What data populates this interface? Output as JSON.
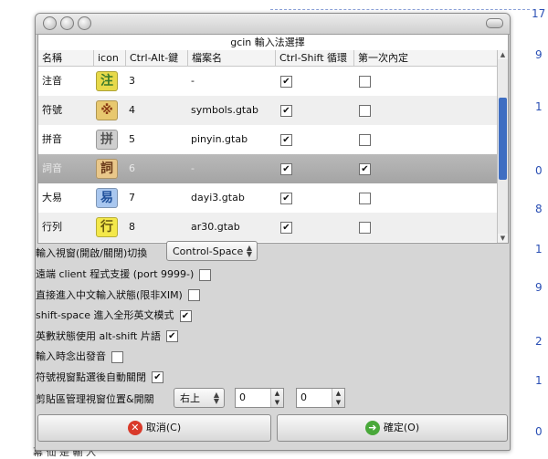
{
  "background": {
    "fragments": [
      "17",
      "9",
      "1",
      "0",
      "8",
      "1",
      "9",
      "2",
      "1",
      "0"
    ],
    "bottom_text": "幕 仙 是 輸 入"
  },
  "window": {
    "title": "gcin 輸入法選擇"
  },
  "table": {
    "columns": [
      "名稱",
      "icon",
      "Ctrl-Alt-鍵",
      "檔案名",
      "Ctrl-Shift 循環",
      "第一次內定"
    ],
    "rows": [
      {
        "name": "注音",
        "icon_char": "注",
        "icon_bg": "#e7d94a",
        "icon_fg": "#3a7a2a",
        "key": "3",
        "file": "-",
        "cycle": true,
        "default": false
      },
      {
        "name": "符號",
        "icon_char": "※",
        "icon_bg": "#e8c86f",
        "icon_fg": "#8a3a14",
        "key": "4",
        "file": "symbols.gtab",
        "cycle": true,
        "default": false
      },
      {
        "name": "拼音",
        "icon_char": "拼",
        "icon_bg": "#cfcfcf",
        "icon_fg": "#555555",
        "key": "5",
        "file": "pinyin.gtab",
        "cycle": true,
        "default": false
      },
      {
        "name": "詞音",
        "icon_char": "詞",
        "icon_bg": "#e9c78a",
        "icon_fg": "#6a3a1a",
        "key": "6",
        "file": "-",
        "cycle": true,
        "default": true
      },
      {
        "name": "大易",
        "icon_char": "易",
        "icon_bg": "#a9c7ef",
        "icon_fg": "#1e4f9a",
        "key": "7",
        "file": "dayi3.gtab",
        "cycle": true,
        "default": false
      },
      {
        "name": "行列",
        "icon_char": "行",
        "icon_bg": "#f4e84a",
        "icon_fg": "#6a5a10",
        "key": "8",
        "file": "ar30.gtab",
        "cycle": true,
        "default": false
      }
    ]
  },
  "options": {
    "switch_label": "輸入視窗(開啟/關閉)切換",
    "switch_value": "Control-Space",
    "items": [
      {
        "label": "遠端 client 程式支援 (port 9999-)",
        "checked": false
      },
      {
        "label": "直接進入中文輸入狀態(限非XIM)",
        "checked": false
      },
      {
        "label": "shift-space 進入全形英文模式",
        "checked": true
      },
      {
        "label": "英數狀態使用 alt-shift 片語",
        "checked": true
      },
      {
        "label": "輸入時念出發音",
        "checked": false
      },
      {
        "label": "符號視窗點選後自動關閉",
        "checked": true
      }
    ],
    "clipboard_label": "剪貼區管理視窗位置&開關",
    "clipboard_position": "右上",
    "spin_x": "0",
    "spin_y": "0"
  },
  "buttons": {
    "cancel": "取消(C)",
    "ok": "確定(O)"
  },
  "colors": {
    "cancel_icon": "#d93a2a",
    "ok_icon": "#49a83a"
  }
}
